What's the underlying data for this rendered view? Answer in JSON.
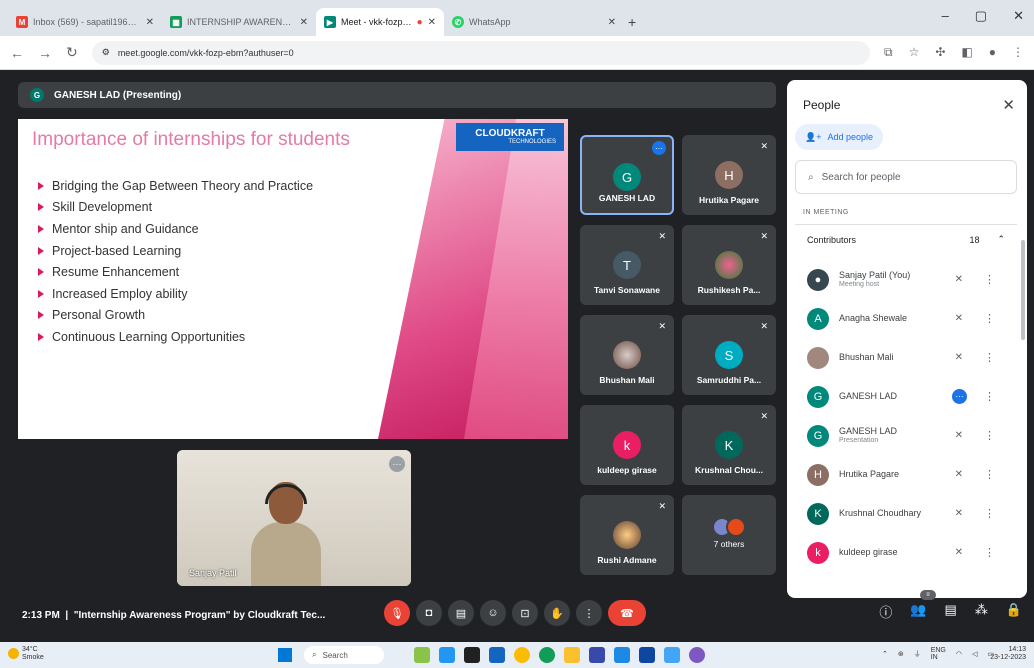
{
  "browser": {
    "tabs": [
      {
        "label": "Inbox (569) - sapatil1969@gm...",
        "icon": "gmail-icon",
        "color": "#ea4335",
        "active": false
      },
      {
        "label": "INTERNSHIP AWARENESS PRO...",
        "icon": "sheets-icon",
        "color": "#0f9d58",
        "active": false
      },
      {
        "label": "Meet - vkk-fozp-ebm",
        "icon": "meet-icon",
        "color": "#00897b",
        "active": true
      },
      {
        "label": "",
        "icon": "record-icon",
        "color": "#ea4335",
        "active": false
      },
      {
        "label": "WhatsApp",
        "icon": "whatsapp-icon",
        "color": "#25d366",
        "active": false
      }
    ],
    "url": "meet.google.com/vkk-fozp-ebm?authuser=0"
  },
  "meet": {
    "presenter_bar": "GANESH LAD (Presenting)",
    "presenter_initial": "G",
    "slide": {
      "title": "Importance of internships for students",
      "logo_text": "CLOUDKRAFT",
      "logo_sub": "TECHNOLOGIES",
      "bullets": [
        "Bridging the Gap Between Theory and Practice",
        "Skill Development",
        "Mentor ship and Guidance",
        "Project-based Learning",
        "Resume Enhancement",
        "Increased Employ ability",
        "Personal Growth",
        "Continuous Learning Opportunities"
      ]
    },
    "self_view_name": "Sanjay Patil",
    "tiles": [
      {
        "name": "GANESH LAD",
        "initial": "G",
        "color": "#00897b",
        "active": true
      },
      {
        "name": "Hrutika Pagare",
        "initial": "H",
        "color": "#8d6e63",
        "active": false
      },
      {
        "name": "Tanvi Sonawane",
        "initial": "T",
        "color": "#455a64",
        "active": false
      },
      {
        "name": "Rushikesh Pa...",
        "initial": "",
        "color": "#c2185b",
        "active": false
      },
      {
        "name": "Bhushan Mali",
        "initial": "",
        "color": "#a1887f",
        "active": false
      },
      {
        "name": "Samruddhi Pa...",
        "initial": "S",
        "color": "#00acc1",
        "active": false
      },
      {
        "name": "kuldeep girase",
        "initial": "k",
        "color": "#e91e63",
        "active": false
      },
      {
        "name": "Krushnal Chou...",
        "initial": "K",
        "color": "#00695c",
        "active": false
      },
      {
        "name": "Rushi Admane",
        "initial": "",
        "color": "#a1887f",
        "active": false
      },
      {
        "name": "7 others",
        "initial": "",
        "color": "#5f6368",
        "active": false
      }
    ],
    "controls": {
      "time": "2:13 PM",
      "meeting_title": "\"Internship Awareness Program\" by Cloudkraft Tec..."
    }
  },
  "people_panel": {
    "title": "People",
    "add_people": "Add people",
    "search_placeholder": "Search for people",
    "in_meeting": "IN MEETING",
    "contributors_label": "Contributors",
    "contributors_count": "18",
    "participants": [
      {
        "name": "Sanjay Patil (You)",
        "sub": "Meeting host",
        "initial": "",
        "color": "#37474f"
      },
      {
        "name": "Anagha Shewale",
        "sub": "",
        "initial": "A",
        "color": "#00897b"
      },
      {
        "name": "Bhushan Mali",
        "sub": "",
        "initial": "",
        "color": "#a1887f"
      },
      {
        "name": "GANESH LAD",
        "sub": "",
        "initial": "G",
        "color": "#00897b"
      },
      {
        "name": "GANESH LAD",
        "sub": "Presentation",
        "initial": "G",
        "color": "#00897b"
      },
      {
        "name": "Hrutika Pagare",
        "sub": "",
        "initial": "H",
        "color": "#8d6e63"
      },
      {
        "name": "Krushnal Choudhary",
        "sub": "",
        "initial": "K",
        "color": "#00695c"
      },
      {
        "name": "kuldeep girase",
        "sub": "",
        "initial": "k",
        "color": "#e91e63"
      }
    ]
  },
  "taskbar": {
    "temp": "34°C",
    "weather": "Smoke",
    "search": "Search",
    "lang": "ENG",
    "region": "IN",
    "time": "14:13",
    "date": "23-12-2023"
  }
}
